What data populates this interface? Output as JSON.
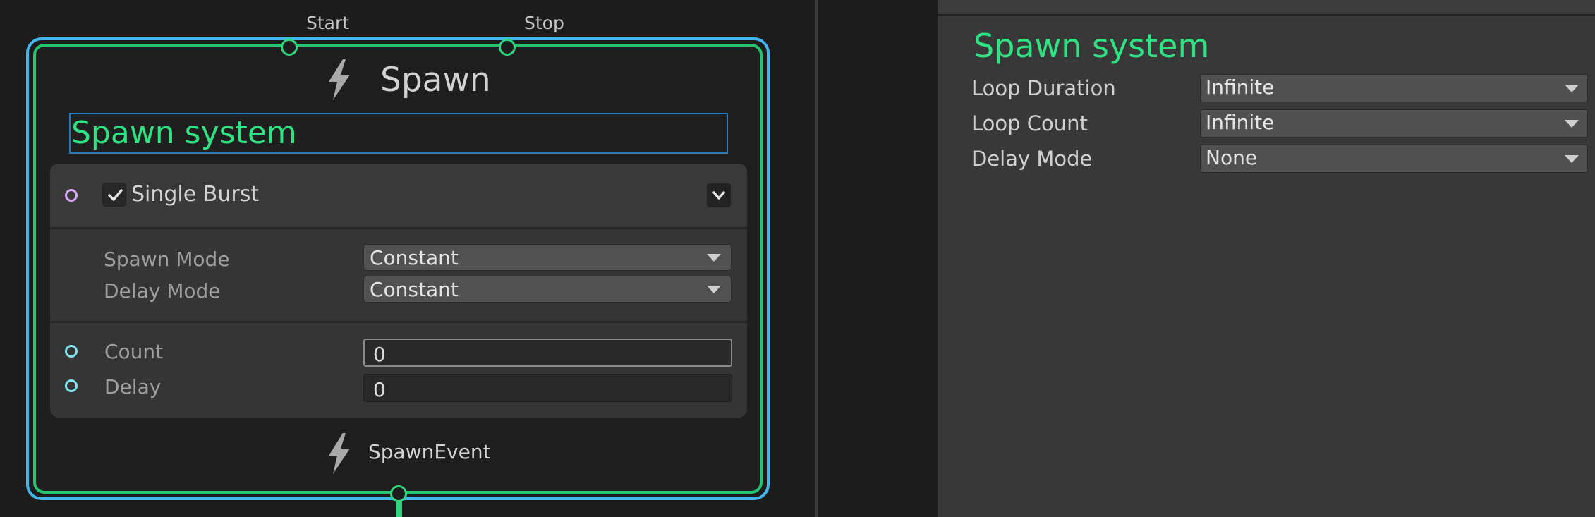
{
  "graph": {
    "flow_inputs": {
      "start_label": "Start",
      "stop_label": "Stop"
    },
    "node": {
      "title": "Spawn",
      "title_icon": "lightning-bolt-icon",
      "label_value": "Spawn system",
      "block": {
        "title": "Single Burst",
        "enabled": true,
        "collapse_icon": "chevron-down-icon",
        "settings": [
          {
            "label": "Spawn Mode",
            "value": "Constant"
          },
          {
            "label": "Delay Mode",
            "value": "Constant"
          }
        ],
        "inputs": [
          {
            "label": "Count",
            "value": "0"
          },
          {
            "label": "Delay",
            "value": "0"
          }
        ]
      },
      "output": {
        "label": "SpawnEvent",
        "icon": "lightning-bolt-icon"
      }
    }
  },
  "inspector": {
    "title": "Spawn system",
    "properties": [
      {
        "label": "Loop Duration",
        "value": "Infinite"
      },
      {
        "label": "Loop Count",
        "value": "Infinite"
      },
      {
        "label": "Delay Mode",
        "value": "None"
      }
    ]
  },
  "colors": {
    "accent_green": "#2ee382",
    "flow_green": "#25c46f",
    "selection_blue": "#43b6ee",
    "port_purple": "#d7a9f5",
    "port_cyan": "#7fe3ee"
  }
}
